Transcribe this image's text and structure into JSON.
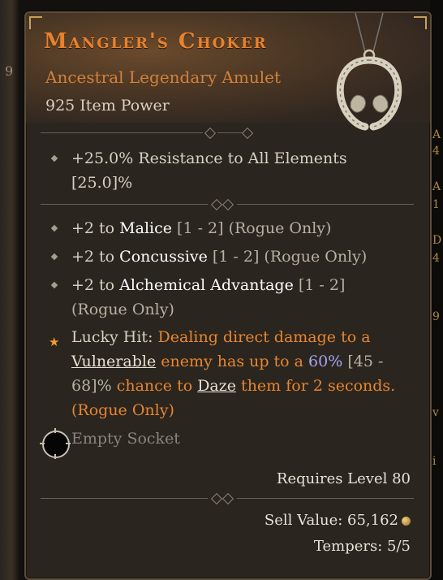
{
  "item": {
    "name": "Mangler's Choker",
    "type": "Ancestral Legendary Amulet",
    "item_power": "925 Item Power",
    "icon": "amulet-icon"
  },
  "implicit": {
    "line1": "+25.0% Resistance to All Elements",
    "line2": "[25.0]%"
  },
  "affixes": [
    {
      "prefix": "+2 to ",
      "name": "Malice",
      "range": " [1 - 2] (Rogue Only)"
    },
    {
      "prefix": "+2 to ",
      "name": "Concussive",
      "range": " [1 - 2] (Rogue Only)"
    },
    {
      "prefix": "+2 to ",
      "name": "Alchemical Advantage",
      "range": " [1 - 2]",
      "cont": "(Rogue Only)"
    }
  ],
  "lucky_hit": {
    "label": "Lucky Hit: ",
    "p1": "Dealing direct damage to a",
    "kw1": "Vulnerable",
    "p2": " enemy has up to a ",
    "value": "60%",
    "range": " [45 -",
    "range2": "68]%",
    "p3": " chance to ",
    "kw2": "Daze",
    "p4": " them for 2 seconds.",
    "p5": "(Rogue Only)"
  },
  "socket": {
    "label": "Empty Socket"
  },
  "footer": {
    "requires": "Requires Level 80",
    "sell": "Sell Value: 65,162",
    "tempers": "Tempers: 5/5"
  },
  "background": {
    "left_glyph": "9",
    "right_chars": [
      "A",
      "4",
      "A",
      "1",
      "D",
      "4",
      "9",
      "v",
      "i"
    ]
  },
  "colors": {
    "title": "#e8812c",
    "subtitle": "#d2813a",
    "keyword_orange": "#e6862f",
    "value_blue": "#a8a6f0",
    "lucky_star": "#f0a02a"
  }
}
